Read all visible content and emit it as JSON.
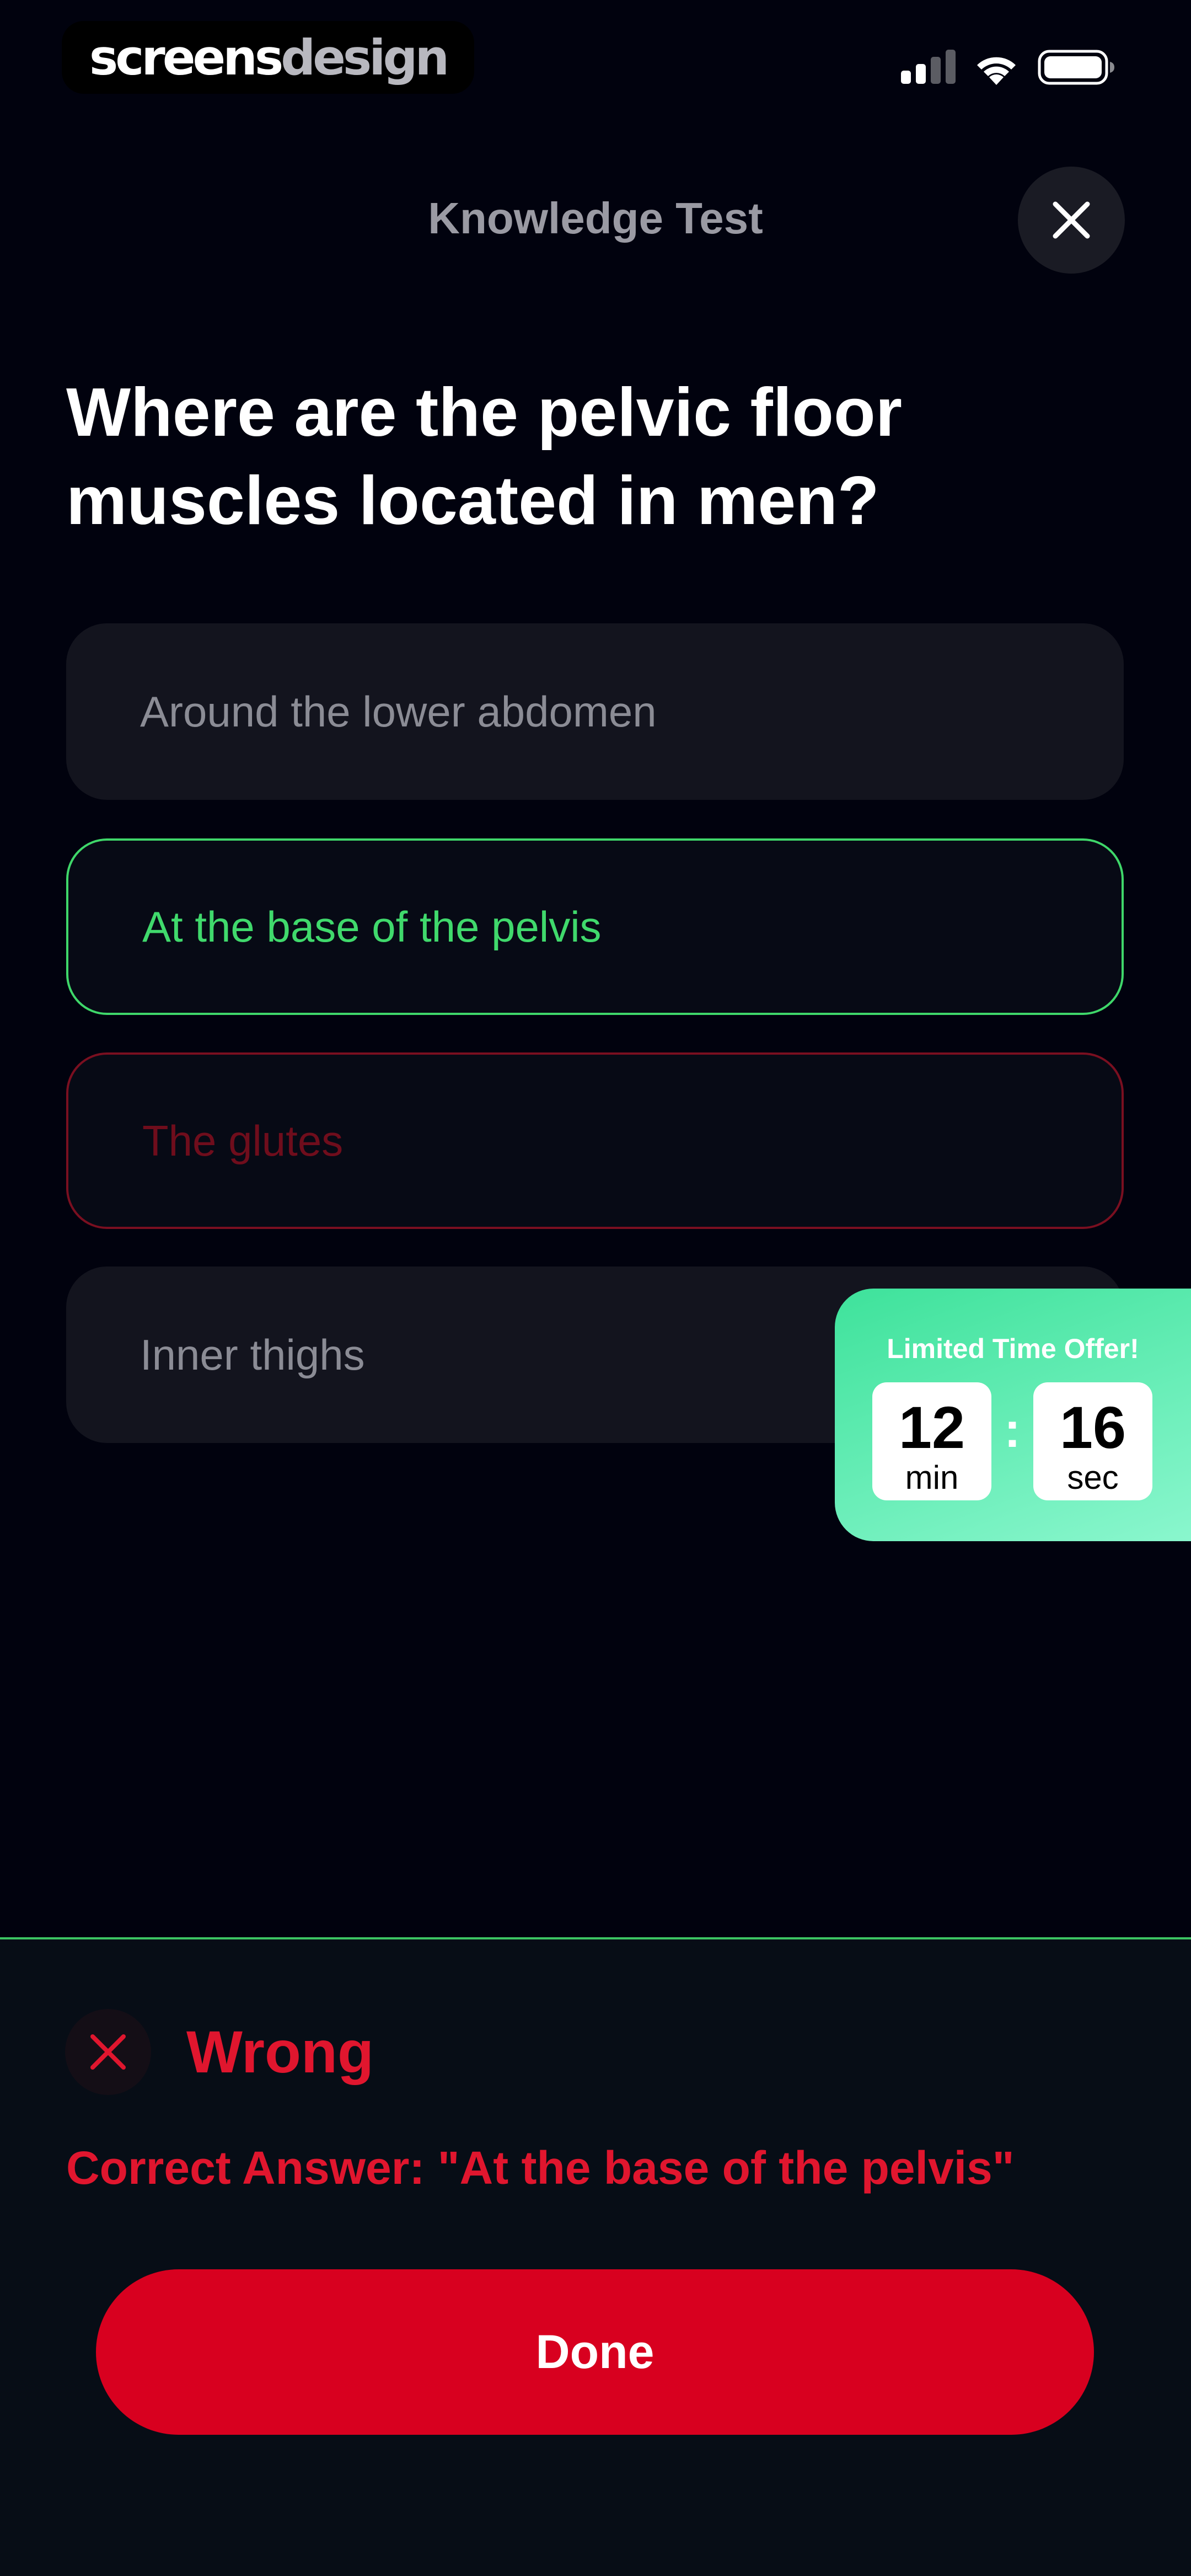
{
  "status_bar": {
    "brand_part1": "screens",
    "brand_part2": "design"
  },
  "header": {
    "title": "Knowledge Test"
  },
  "question": {
    "text": "Where are the pelvic floor muscles located in men?"
  },
  "options": [
    {
      "label": "Around the lower abdomen",
      "state": "neutral"
    },
    {
      "label": "At the base of the pelvis",
      "state": "correct"
    },
    {
      "label": "The glutes",
      "state": "wrong"
    },
    {
      "label": "Inner thighs",
      "state": "neutral"
    }
  ],
  "offer": {
    "title": "Limited Time Offer!",
    "minutes": "12",
    "minutes_unit": "min",
    "seconds": "16",
    "seconds_unit": "sec",
    "separator": ":"
  },
  "result": {
    "title": "Wrong",
    "correct_answer_text": "Correct Answer: \"At the base of the pelvis\"",
    "button_label": "Done"
  },
  "colors": {
    "background": "#01020e",
    "correct_green": "#40d96c",
    "wrong_red": "#e0162e",
    "done_button": "#d8001f",
    "offer_gradient_start": "#3ee29b",
    "offer_gradient_end": "#8cf7cf"
  },
  "icons": {
    "close": "close-icon",
    "result": "x-icon",
    "signal": "cellular-signal-icon",
    "wifi": "wifi-icon",
    "battery": "battery-icon"
  }
}
